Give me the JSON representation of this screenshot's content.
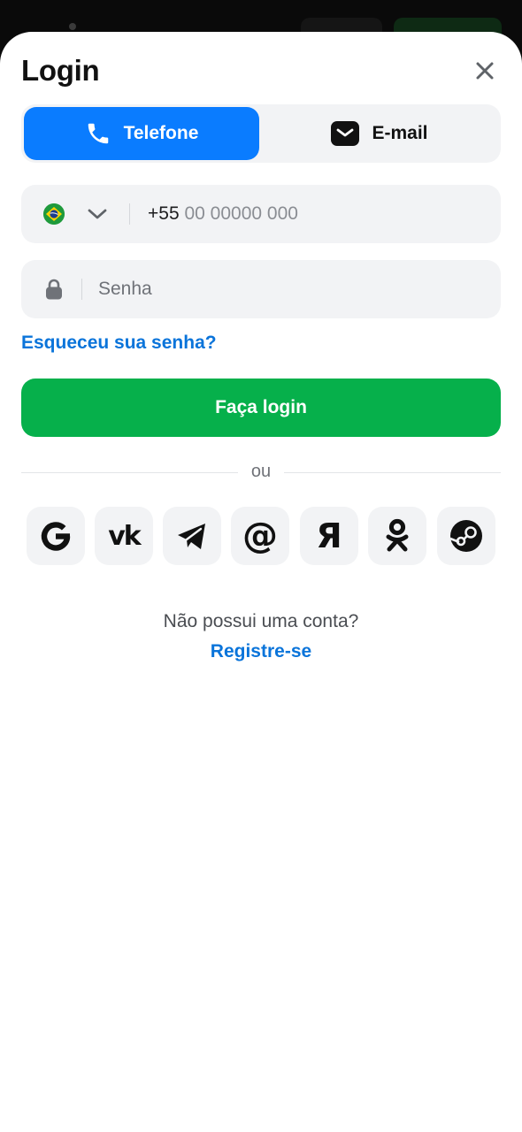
{
  "header": {
    "title": "Login",
    "close_icon": "close-icon"
  },
  "tabs": [
    {
      "label": "Telefone",
      "icon": "phone-icon",
      "active": true
    },
    {
      "label": "E-mail",
      "icon": "mail-icon",
      "active": false
    }
  ],
  "phone_field": {
    "country_flag": "brazil-flag-icon",
    "country_code": "+55",
    "placeholder": "00 00000 000"
  },
  "password_field": {
    "placeholder": "Senha",
    "icon": "lock-icon"
  },
  "forgot_link": "Esqueceu sua senha?",
  "login_button": "Faça login",
  "divider_text": "ou",
  "social_logins": [
    "google-icon",
    "vk-icon",
    "telegram-icon",
    "mail-ru-icon",
    "yandex-icon",
    "odnoklassniki-icon",
    "steam-icon"
  ],
  "footer": {
    "prompt": "Não possui uma conta?",
    "register_link": "Registre-se"
  },
  "colors": {
    "accent_blue": "#0a7cff",
    "link_blue": "#0a74da",
    "login_green": "#06b04b",
    "field_bg": "#f2f3f5"
  }
}
